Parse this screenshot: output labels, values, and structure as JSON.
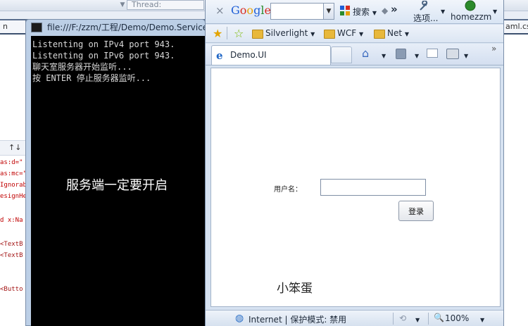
{
  "ide": {
    "thread_label": "Thread:",
    "tab_left_text": "n",
    "tab_right_text": "aml.cs",
    "splitter_label": "↑↓",
    "code_lines": [
      {
        "text": "as:d=\"",
        "color": "#c00000"
      },
      {
        "text": "as:mc=\"",
        "color": "#c00000"
      },
      {
        "text": "Ignorab",
        "color": "#c00000"
      },
      {
        "text": "esignHe",
        "color": "#c00000"
      },
      {
        "text": "d x:Na",
        "color": "#c00000"
      },
      {
        "text": "<TextB",
        "color": "#a31515"
      },
      {
        "text": "<TextB",
        "color": "#a31515"
      },
      {
        "text": "<Butto",
        "color": "#a31515"
      }
    ]
  },
  "console": {
    "title": "file:///F:/zzm/工程/Demo/Demo.Service",
    "lines": [
      "Listenting on IPv4 port 943.",
      "Listenting on IPv6 port 943.",
      "聊天室服务器开始监听...",
      "按 ENTER 停止服务器监听..."
    ],
    "overlay_text": "服务端一定要开启"
  },
  "browser": {
    "google_logo": "Google",
    "search_value": "",
    "search_button_label": "搜索",
    "more_label": "»",
    "options_label": "选项",
    "user_label": "homezzm",
    "favorites": [
      "Silverlight",
      "WCF",
      "Net"
    ],
    "tab_title": "Demo.UI",
    "status_zone": "Internet | 保护模式: 禁用",
    "zoom": "100%",
    "colors": {
      "accent": "#2b8a2b",
      "ie_blue": "#1f66c6"
    }
  },
  "page": {
    "username_label": "用户名：",
    "username_value": "",
    "login_label": "登录",
    "footer_text": "小笨蛋"
  }
}
